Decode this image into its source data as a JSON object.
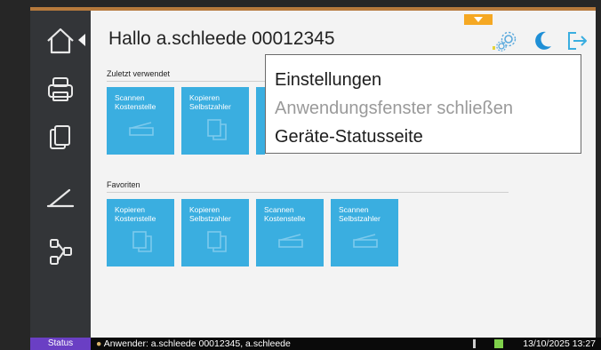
{
  "header": {
    "greeting": "Hallo a.schleede 00012345"
  },
  "sidebar": {
    "items": [
      {
        "icon": "home-icon"
      },
      {
        "icon": "printer-icon"
      },
      {
        "icon": "copy-icon"
      },
      {
        "icon": "scanner-icon"
      },
      {
        "icon": "workflow-icon"
      }
    ]
  },
  "header_icons": [
    "settings-gear-icon",
    "moon-icon",
    "logout-icon"
  ],
  "recent": {
    "label": "Zuletzt verwendet",
    "tiles": [
      {
        "line1": "Scannen",
        "line2": "Kostenstelle",
        "icon": "scan-icon"
      },
      {
        "line1": "Kopieren",
        "line2": "Selbstzahler",
        "icon": "copy-doc-icon"
      }
    ]
  },
  "favorites": {
    "label": "Favoriten",
    "tiles": [
      {
        "line1": "Kopieren",
        "line2": "Kostenstelle",
        "icon": "copy-doc-icon"
      },
      {
        "line1": "Kopieren",
        "line2": "Selbstzahler",
        "icon": "copy-doc-icon"
      },
      {
        "line1": "Scannen",
        "line2": "Kostenstelle",
        "icon": "scan-icon"
      },
      {
        "line1": "Scannen",
        "line2": "Selbstzahler",
        "icon": "scan-icon"
      }
    ]
  },
  "menu": {
    "items": [
      {
        "label": "Einstellungen",
        "enabled": true
      },
      {
        "label": "Anwendungsfenster schließen",
        "enabled": false
      },
      {
        "label": "Geräte-Statusseite",
        "enabled": true
      }
    ]
  },
  "statusbar": {
    "status_label": "Status",
    "user_text": "Anwender: a.schleede 00012345, a.schleede",
    "datetime": "13/10/2025 13:27"
  },
  "colors": {
    "tile": "#3aaee0",
    "accent_blue": "#1f8fd6",
    "status_button": "#6a3fc4",
    "sidebar": "#333538",
    "orange_tab": "#f5a823"
  }
}
